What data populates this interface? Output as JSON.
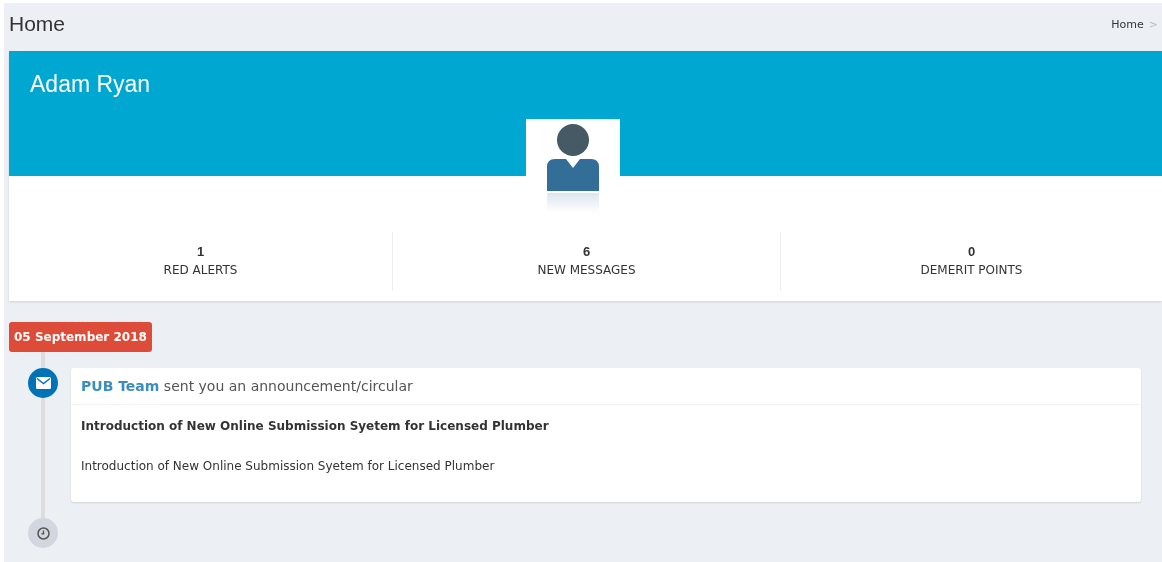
{
  "page": {
    "title": "Home"
  },
  "breadcrumb": {
    "items": [
      "Home"
    ],
    "separator": ">"
  },
  "profile": {
    "name": "Adam Ryan"
  },
  "stats": [
    {
      "value": "1",
      "label": "RED ALERTS"
    },
    {
      "value": "6",
      "label": "NEW MESSAGES"
    },
    {
      "value": "0",
      "label": "DEMERIT POINTS"
    }
  ],
  "timeline": {
    "date": "05 September 2018",
    "items": [
      {
        "kind": "message",
        "sender": "PUB Team",
        "action": "sent you an announcement/circular",
        "subject": "Introduction of New Online Submission Syetem for Licensed Plumber",
        "body": "Introduction of New Online Submission Syetem for Licensed Plumber"
      }
    ]
  }
}
